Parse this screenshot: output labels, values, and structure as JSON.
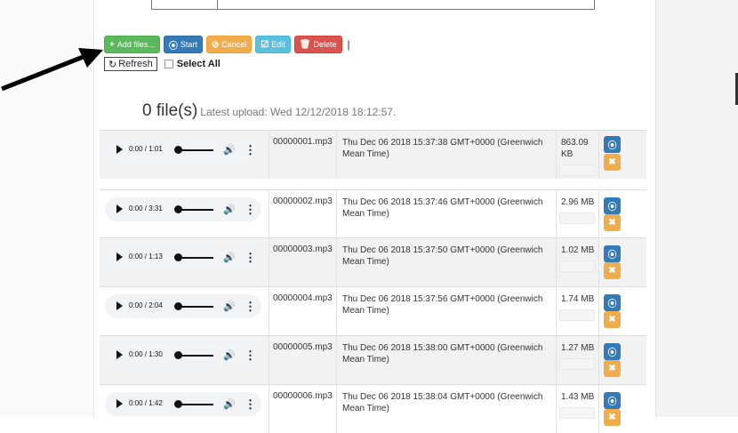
{
  "toolbar": {
    "add_label": "Add files...",
    "start_label": "Start",
    "cancel_label": "Cancel",
    "edit_label": "Edit",
    "delete_label": "Delete",
    "separator": "|",
    "refresh_label": "Refresh",
    "select_all_label": "Select All"
  },
  "summary": {
    "count": "0 file(s)",
    "latest": "Latest upload: Wed 12/12/2018 18:12:57."
  },
  "files": [
    {
      "time": "0:00 / 1:01",
      "name": "00000001.mp3",
      "date": "Thu Dec 06 2018 15:37:38 GMT+0000 (Greenwich Mean Time)",
      "size": "863.09 KB"
    },
    {
      "time": "0:00 / 3:31",
      "name": "00000002.mp3",
      "date": "Thu Dec 06 2018 15:37:46 GMT+0000 (Greenwich Mean Time)",
      "size": "2.96 MB"
    },
    {
      "time": "0:00 / 1:13",
      "name": "00000003.mp3",
      "date": "Thu Dec 06 2018 15:37:50 GMT+0000 (Greenwich Mean Time)",
      "size": "1.02 MB"
    },
    {
      "time": "0:00 / 2:04",
      "name": "00000004.mp3",
      "date": "Thu Dec 06 2018 15:37:56 GMT+0000 (Greenwich Mean Time)",
      "size": "1.74 MB"
    },
    {
      "time": "0:00 / 1:30",
      "name": "00000005.mp3",
      "date": "Thu Dec 06 2018 15:38:00 GMT+0000 (Greenwich Mean Time)",
      "size": "1.27 MB"
    },
    {
      "time": "0:00 / 1:42",
      "name": "00000006.mp3",
      "date": "Thu Dec 06 2018 15:38:04 GMT+0000 (Greenwich Mean Time)",
      "size": "1.43 MB"
    }
  ]
}
